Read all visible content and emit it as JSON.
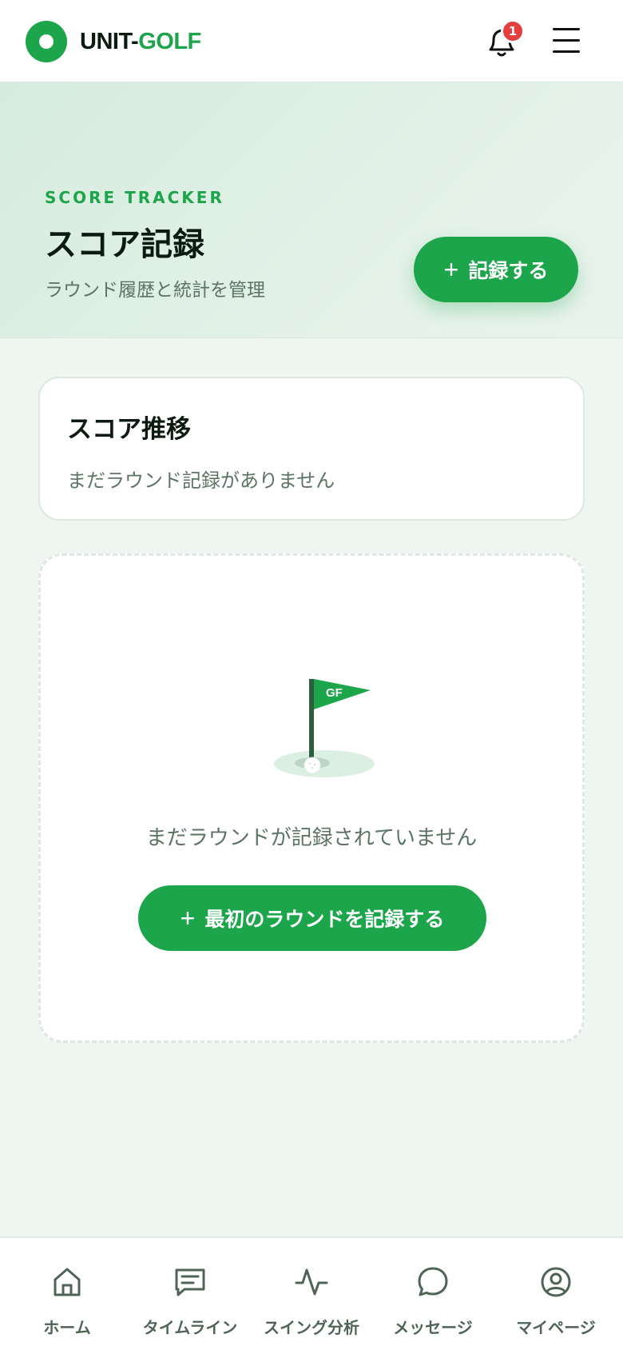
{
  "header": {
    "logo_prefix": "UNIT-",
    "logo_accent": "GOLF",
    "notification_count": "1"
  },
  "hero": {
    "eyebrow": "SCORE TRACKER",
    "title": "スコア記録",
    "subtitle": "ラウンド履歴と統計を管理",
    "record_button": "記録する"
  },
  "trend": {
    "title": "スコア推移",
    "empty_text": "まだラウンド記録がありません"
  },
  "empty_state": {
    "flag_text": "GF",
    "message": "まだラウンドが記録されていません",
    "button": "最初のラウンドを記録する"
  },
  "nav": {
    "items": [
      {
        "label": "ホーム",
        "icon": "home-icon"
      },
      {
        "label": "タイムライン",
        "icon": "timeline-icon"
      },
      {
        "label": "スイング分析",
        "icon": "activity-icon"
      },
      {
        "label": "メッセージ",
        "icon": "message-icon"
      },
      {
        "label": "マイページ",
        "icon": "user-circle-icon"
      }
    ]
  },
  "colors": {
    "brand": "#1da54b",
    "badge": "#e53e3e",
    "text_primary": "#0d1a12",
    "text_muted": "#5c7365"
  }
}
